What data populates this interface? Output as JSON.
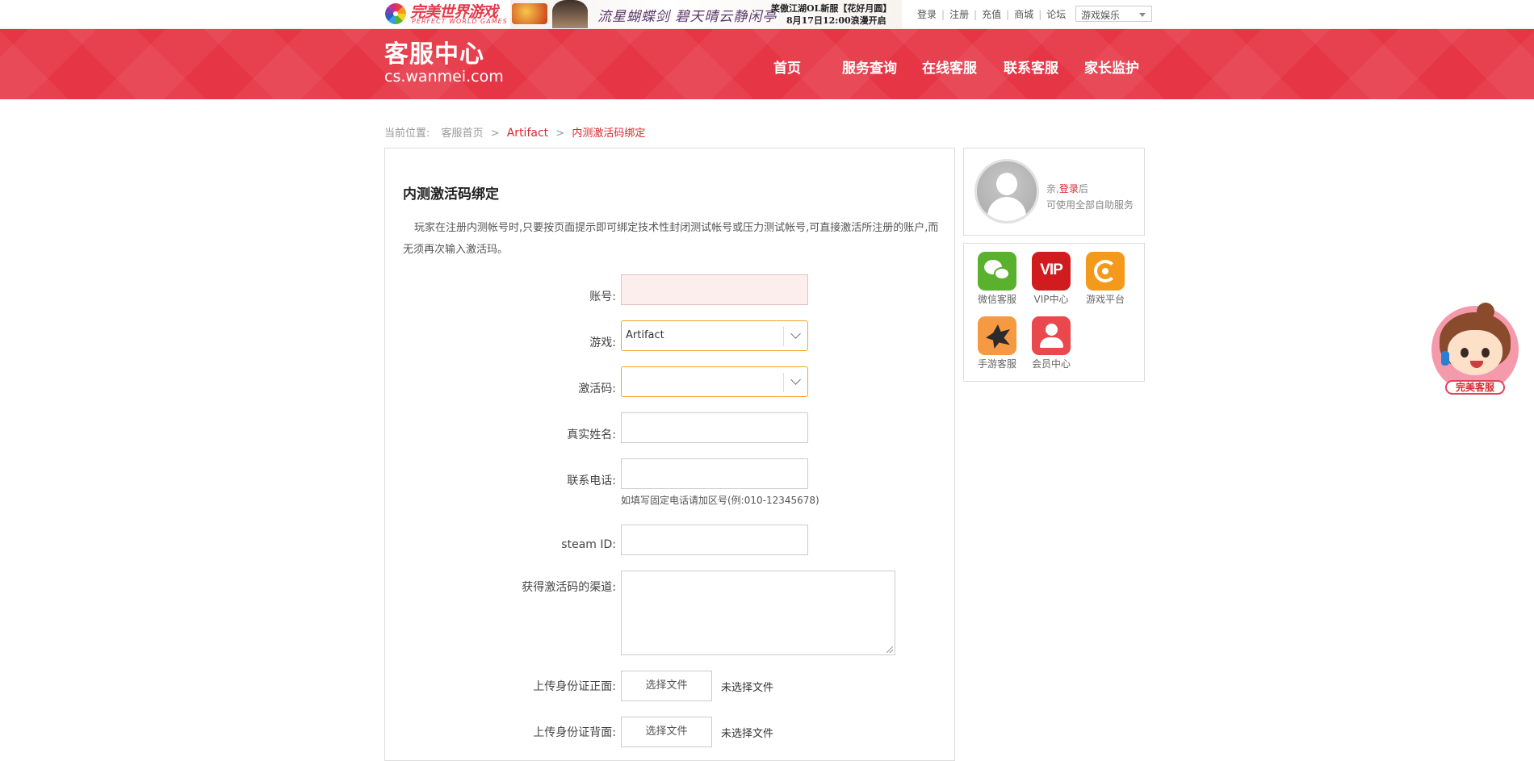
{
  "topbar": {
    "logo_cn": "完美世界游戏",
    "logo_en": "PERFECT WORLD GAMES",
    "ad": {
      "calligraphy": "流星蝴蝶剑 碧天晴云静闲亭",
      "line1": "笑傲江湖OL新服【花好月圆】",
      "line2": "8月17日12:00浪漫开启"
    },
    "links": [
      "登录",
      "注册",
      "充值",
      "商城",
      "论坛"
    ],
    "game_select": "游戏娱乐"
  },
  "header": {
    "brand_cn": "客服中心",
    "brand_en": "cs.wanmei.com",
    "nav": [
      "首页",
      "服务查询",
      "在线客服",
      "联系客服",
      "家长监护"
    ]
  },
  "breadcrumb": {
    "prefix": "当前位置:",
    "home": "客服首页",
    "sep": ">",
    "game": "Artifact",
    "current": "内测激活码绑定"
  },
  "form": {
    "title": "内测激活码绑定",
    "description": "玩家在注册内测帐号时,只要按页面提示即可绑定技术性封闭测试帐号或压力测试帐号,可直接激活所注册的账户,而无须再次输入激活玛。",
    "labels": {
      "account": "账号:",
      "game": "游戏:",
      "code": "激活码:",
      "real_name": "真实姓名:",
      "phone": "联系电话:",
      "steam_id": "steam ID:",
      "channel": "获得激活码的渠道:",
      "id_front": "上传身份证正面:",
      "id_back": "上传身份证背面:"
    },
    "game_value": "Artifact",
    "code_value": "",
    "phone_hint": "如填写固定电话请加区号(例:010-12345678)",
    "file_button": "选择文件",
    "file_status": "未选择文件"
  },
  "sidebar": {
    "login_prefix": "亲,",
    "login_link": "登录",
    "login_suffix": "后",
    "login_line2": "可使用全部自助服务",
    "apps": [
      {
        "label": "微信客服",
        "icon": "wechat-icon"
      },
      {
        "label": "VIP中心",
        "icon": "vip-icon",
        "icon_text": "VIP"
      },
      {
        "label": "游戏平台",
        "icon": "game-platform-icon"
      },
      {
        "label": "手游客服",
        "icon": "mobile-game-icon"
      },
      {
        "label": "会员中心",
        "icon": "member-icon"
      }
    ]
  },
  "mascot": {
    "tag": "完美客服"
  },
  "colors": {
    "brand_red": "#e63646",
    "link_red": "#d6292d",
    "focus_orange": "#f5a623"
  }
}
